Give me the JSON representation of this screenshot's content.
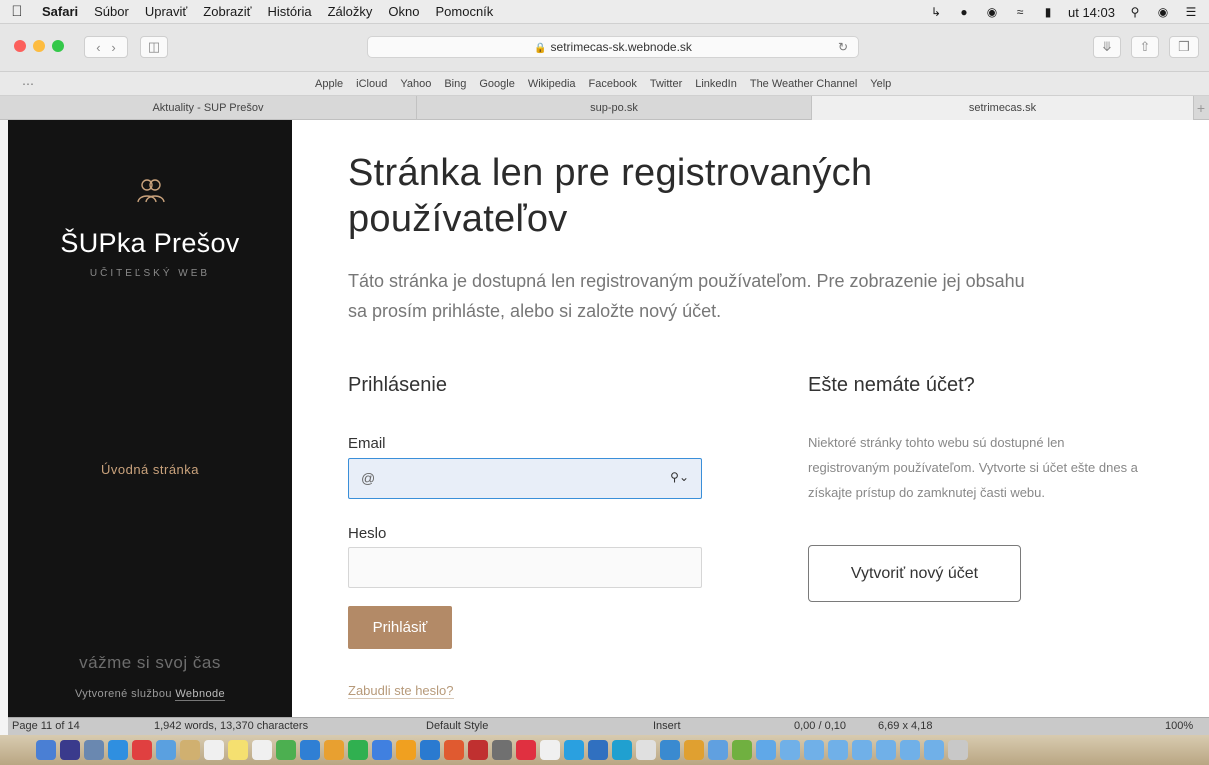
{
  "menubar": {
    "items": [
      "Safari",
      "Súbor",
      "Upraviť",
      "Zobraziť",
      "História",
      "Záložky",
      "Okno",
      "Pomocník"
    ],
    "clock": "ut 14:03"
  },
  "toolbar": {
    "url": "setrimecas-sk.webnode.sk"
  },
  "favorites": [
    "Apple",
    "iCloud",
    "Yahoo",
    "Bing",
    "Google",
    "Wikipedia",
    "Facebook",
    "Twitter",
    "LinkedIn",
    "The Weather Channel",
    "Yelp"
  ],
  "tabs": [
    {
      "label": "Aktuality - SUP Prešov"
    },
    {
      "label": "sup-po.sk"
    },
    {
      "label": "setrimecas.sk"
    }
  ],
  "sidebar": {
    "title": "ŠUPka Prešov",
    "subtitle": "UČITEĽSKÝ WEB",
    "nav_home": "Úvodná stránka",
    "motto": "vážme si svoj čas",
    "credit_prefix": "Vytvorené službou",
    "credit_link": "Webnode"
  },
  "main": {
    "title": "Stránka len pre registrovaných používateľov",
    "intro": "Táto stránka je dostupná len registrovaným používateľom. Pre zobrazenie jej obsahu sa prosím prihláste, alebo si založte nový účet.",
    "login": {
      "heading": "Prihlásenie",
      "email_label": "Email",
      "email_value": "@",
      "password_label": "Heslo",
      "submit": "Prihlásiť",
      "forgot": "Zabudli ste heslo?"
    },
    "register": {
      "heading": "Ešte nemáte účet?",
      "text": "Niektoré stránky tohto webu sú dostupné len registrovaným používateľom. Vytvorte si účet ešte dnes a získajte prístup do zamknutej časti webu.",
      "button": "Vytvoriť nový účet"
    }
  },
  "statusbar": {
    "page": "Page 11 of 14",
    "words": "1,942 words, 13,370 characters",
    "style": "Default Style",
    "mode": "Insert",
    "coords": "0,00 / 0,10",
    "size": "6,69 x 4,18",
    "zoom": "100%"
  },
  "colors": {
    "accent": "#b38a67",
    "sidebar_bg": "#131313",
    "nav_link": "#c9a27c"
  }
}
